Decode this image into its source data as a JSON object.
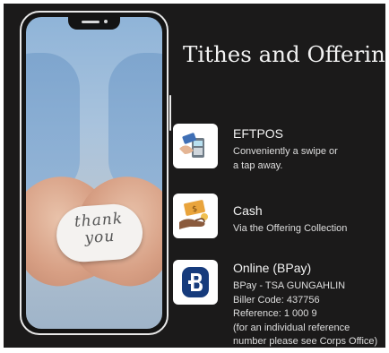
{
  "title": "Tithes and Offering",
  "phone": {
    "card_line1": "thank",
    "card_line2": "you"
  },
  "items": [
    {
      "title": "EFTPOS",
      "icon": "card-terminal-icon",
      "lines": [
        "Conveniently a swipe or",
        "a tap away."
      ]
    },
    {
      "title": "Cash",
      "icon": "cash-hand-icon",
      "lines": [
        "Via the Offering Collection"
      ]
    },
    {
      "title": "Online (BPay)",
      "icon": "bpay-logo-icon",
      "lines": [
        "BPay - TSA GUNGAHLIN",
        "Biller Code: 437756",
        "Reference: 1 000 9",
        "(for an individual reference",
        "number please see Corps Office)"
      ]
    }
  ],
  "colors": {
    "background": "#1b1a1a",
    "text": "#f2f2f2",
    "bpay_blue": "#163b7c"
  }
}
